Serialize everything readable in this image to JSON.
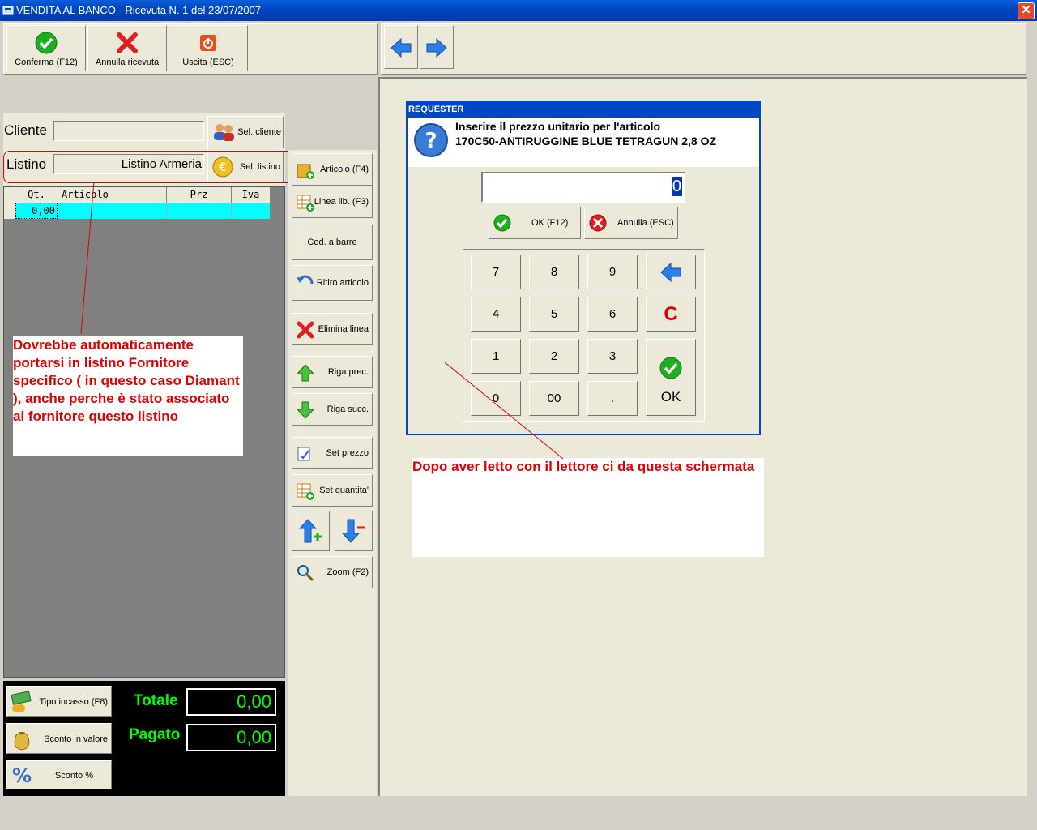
{
  "window": {
    "title": "VENDITA AL BANCO - Ricevuta N. 1 del 23/07/2007"
  },
  "toolbar": {
    "confirm_label": "Conferma (F12)",
    "cancel_label": "Annulla ricevuta",
    "exit_label": "Uscita (ESC)"
  },
  "customer": {
    "label": "Cliente",
    "value": "",
    "select_label": "Sel. cliente"
  },
  "pricelist": {
    "label": "Listino",
    "value": "Listino  Armeria",
    "select_label": "Sel. listino"
  },
  "grid": {
    "columns": [
      "Qt.",
      "Articolo",
      "Prz",
      "Iva"
    ],
    "rows": [
      {
        "qty": "0,00",
        "article": "",
        "price": "",
        "vat": ""
      }
    ]
  },
  "side_buttons": {
    "article": "Articolo (F4)",
    "free_line": "Linea lib. (F3)",
    "barcode": "Cod. a barre",
    "return_item": "Ritiro articolo",
    "delete_line": "Elimina linea",
    "prev_row": "Riga prec.",
    "next_row": "Riga succ.",
    "set_price": "Set prezzo",
    "set_qty": "Set quantita'",
    "zoom": "Zoom (F2)"
  },
  "totals": {
    "payment_type_label": "Tipo incasso (F8)",
    "discount_value_label": "Sconto in valore",
    "discount_pct_label": "Sconto %",
    "total_label": "Totale",
    "total_value": "0,00",
    "paid_label": "Pagato",
    "paid_value": "0,00"
  },
  "requester": {
    "title": "REQUESTER",
    "message_line1": "Inserire il prezzo unitario per l'articolo",
    "message_line2": "170C50-ANTIRUGGINE BLUE TETRAGUN 2,8 OZ",
    "input_value": "0",
    "ok_label": "OK (F12)",
    "cancel_label": "Annulla (ESC)",
    "keys": {
      "k7": "7",
      "k8": "8",
      "k9": "9",
      "k4": "4",
      "k5": "5",
      "k6": "6",
      "clear": "C",
      "k1": "1",
      "k2": "2",
      "k3": "3",
      "k0": "0",
      "k00": "00",
      "dot": ".",
      "ok": "OK"
    }
  },
  "annotations": {
    "note_left": "Dovrebbe automaticamente portarsi in listino Fornitore specifico ( in questo caso Diamant ), anche perche è stato associato al  fornitore questo listino",
    "note_right": "Dopo aver letto  con  il lettore  ci  da  questa schermata"
  },
  "colors": {
    "titlebar": "#0047c4",
    "selected_row": "#00ffff",
    "totals_bg": "#000000",
    "total_label": "#00ff00",
    "paid_label": "#00ff00",
    "annotation": "#e00000"
  }
}
